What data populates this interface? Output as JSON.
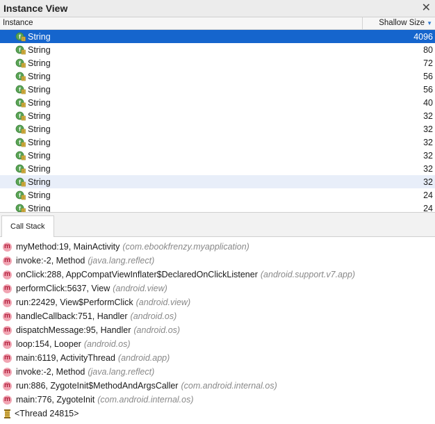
{
  "panel": {
    "title": "Instance View",
    "close_glyph": "✕"
  },
  "table": {
    "col_instance": "Instance",
    "col_size": "Shallow Size",
    "sort_arrow": "▼",
    "rows": [
      {
        "name": "String",
        "size": "4096",
        "state": "selected"
      },
      {
        "name": "String",
        "size": "80",
        "state": ""
      },
      {
        "name": "String",
        "size": "72",
        "state": ""
      },
      {
        "name": "String",
        "size": "56",
        "state": ""
      },
      {
        "name": "String",
        "size": "56",
        "state": ""
      },
      {
        "name": "String",
        "size": "40",
        "state": ""
      },
      {
        "name": "String",
        "size": "32",
        "state": ""
      },
      {
        "name": "String",
        "size": "32",
        "state": ""
      },
      {
        "name": "String",
        "size": "32",
        "state": ""
      },
      {
        "name": "String",
        "size": "32",
        "state": ""
      },
      {
        "name": "String",
        "size": "32",
        "state": ""
      },
      {
        "name": "String",
        "size": "32",
        "state": "hover"
      },
      {
        "name": "String",
        "size": "24",
        "state": ""
      },
      {
        "name": "String",
        "size": "24",
        "state": ""
      }
    ]
  },
  "tabs": {
    "call_stack": "Call Stack"
  },
  "call_stack": {
    "method_icon_letter": "m",
    "frames": [
      {
        "method": "myMethod:19, MainActivity",
        "pkg": "(com.ebookfrenzy.myapplication)"
      },
      {
        "method": "invoke:-2, Method",
        "pkg": "(java.lang.reflect)"
      },
      {
        "method": "onClick:288, AppCompatViewInflater$DeclaredOnClickListener",
        "pkg": "(android.support.v7.app)"
      },
      {
        "method": "performClick:5637, View",
        "pkg": "(android.view)"
      },
      {
        "method": "run:22429, View$PerformClick",
        "pkg": "(android.view)"
      },
      {
        "method": "handleCallback:751, Handler",
        "pkg": "(android.os)"
      },
      {
        "method": "dispatchMessage:95, Handler",
        "pkg": "(android.os)"
      },
      {
        "method": "loop:154, Looper",
        "pkg": "(android.os)"
      },
      {
        "method": "main:6119, ActivityThread",
        "pkg": "(android.app)"
      },
      {
        "method": "invoke:-2, Method",
        "pkg": "(java.lang.reflect)"
      },
      {
        "method": "run:886, ZygoteInit$MethodAndArgsCaller",
        "pkg": "(com.android.internal.os)"
      },
      {
        "method": "main:776, ZygoteInit",
        "pkg": "(com.android.internal.os)"
      }
    ],
    "thread": "<Thread 24815>"
  },
  "colors": {
    "selection": "#1565cd",
    "hover_row": "#e8eef9",
    "method_icon_bg": "#f1a5b3",
    "field_icon": "#4c9a4a"
  }
}
